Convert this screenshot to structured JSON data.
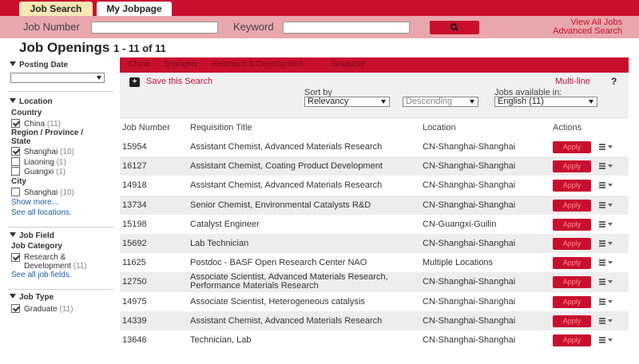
{
  "tabs": [
    {
      "label": "Job Search",
      "active": true
    },
    {
      "label": "My Jobpage",
      "active": false
    }
  ],
  "search": {
    "job_number_label": "Job Number",
    "job_number_value": "",
    "keyword_label": "Keyword",
    "keyword_value": "",
    "go_icon": "search-icon",
    "view_all_label": "View All Jobs",
    "advanced_label": "Advanced Search"
  },
  "title": {
    "main": "Job Openings",
    "count": "1 - 11 of 11"
  },
  "sidebar": {
    "posting_date": {
      "heading": "Posting Date",
      "selected": ""
    },
    "location": {
      "heading": "Location",
      "country_label": "Country",
      "countries": [
        {
          "label": "China",
          "count": "(11)",
          "checked": true
        }
      ],
      "region_label": "Region / Province / State",
      "regions": [
        {
          "label": "Shanghai",
          "count": "(10)",
          "checked": true
        },
        {
          "label": "Liaoning",
          "count": "(1)",
          "checked": false
        },
        {
          "label": "Guangxi",
          "count": "(1)",
          "checked": false
        }
      ],
      "city_label": "City",
      "cities": [
        {
          "label": "Shanghai",
          "count": "(10)",
          "checked": false
        }
      ],
      "show_more": "Show more...",
      "see_all": "See all locations."
    },
    "job_field": {
      "heading": "Job Field",
      "category_label": "Job Category",
      "categories": [
        {
          "label": "Research & Development",
          "count": "(11)",
          "checked": true
        }
      ],
      "see_all": "See all job fields."
    },
    "job_type": {
      "heading": "Job Type",
      "types": [
        {
          "label": "Graduate",
          "count": "(11)",
          "checked": true
        }
      ]
    }
  },
  "filters": [
    "China",
    "Shanghai",
    "Research & Development",
    "Graduate"
  ],
  "options": {
    "save_search": "Save this Search",
    "multiline": "Multi-line",
    "help": "?",
    "sort_by_label": "Sort by",
    "sort_by_value": "Relevancy",
    "order_value": "Descending",
    "jobs_available_label": "Jobs available in:",
    "jobs_available_value": "English (11)"
  },
  "table": {
    "headers": {
      "job_number": "Job Number",
      "title": "Requisition Title",
      "location": "Location",
      "actions": "Actions"
    },
    "apply_label": "Apply",
    "rows": [
      {
        "number": "15954",
        "title": "Assistant Chemist, Advanced Materials Research",
        "location": "CN-Shanghai-Shanghai"
      },
      {
        "number": "16127",
        "title": "Assistant Chemist, Coating Product Development",
        "location": "CN-Shanghai-Shanghai"
      },
      {
        "number": "14918",
        "title": "Assistant Chemist, Advanced Materials Research",
        "location": "CN-Shanghai-Shanghai"
      },
      {
        "number": "13734",
        "title": "Senior Chemist, Environmental Catalysts R&D",
        "location": "CN-Shanghai-Shanghai"
      },
      {
        "number": "15198",
        "title": "Catalyst Engineer",
        "location": "CN-Guangxi-Guilin"
      },
      {
        "number": "15692",
        "title": "Lab Technician",
        "location": "CN-Shanghai-Shanghai"
      },
      {
        "number": "11625",
        "title": "Postdoc - BASF Open Research Center NAO",
        "location": "Multiple Locations"
      },
      {
        "number": "12750",
        "title": "Associate Scientist, Advanced Materials Research, Performance Materials Research",
        "location": "CN-Shanghai-Shanghai"
      },
      {
        "number": "14975",
        "title": "Associate Scientist, Heterogeneous catalysis",
        "location": "CN-Shanghai-Shanghai"
      },
      {
        "number": "14339",
        "title": "Assistant Chemist, Advanced Materials Research",
        "location": "CN-Shanghai-Shanghai"
      },
      {
        "number": "13646",
        "title": "Technician, Lab",
        "location": "CN-Shanghai-Shanghai"
      }
    ]
  },
  "colors": {
    "brand_red": "#c8102e",
    "search_bar_pink": "#e8a7ad",
    "active_tab": "#f6e7b4",
    "link_blue": "#1a5dab"
  }
}
